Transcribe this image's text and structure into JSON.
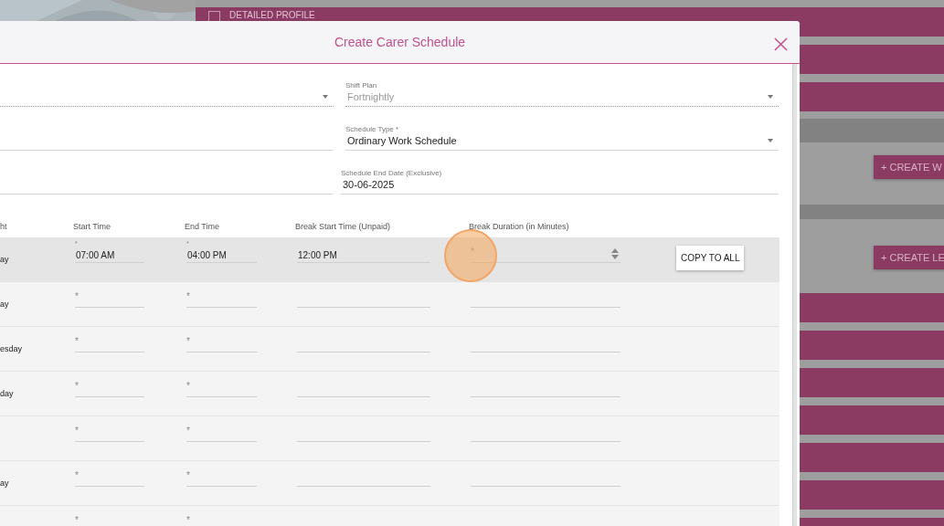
{
  "background": {
    "profile_label": "DETAILED PROFILE",
    "buttons": [
      "+ CREATE W",
      "+ CREATE LE"
    ]
  },
  "dialog": {
    "title": "Create Carer Schedule"
  },
  "fields": [
    {
      "kind": "select",
      "disabled": true
    },
    {
      "kind": "select",
      "label": "Shift Plan",
      "value": "Fortnightly",
      "disabled": true
    },
    {
      "kind": "text",
      "disabled": false
    },
    {
      "kind": "select",
      "label": "Schedule Type *",
      "value": "Ordinary Work Schedule",
      "disabled": false
    },
    {
      "kind": "text",
      "disabled": false
    },
    {
      "kind": "date",
      "label": "Schedule End Date (Exclusive)",
      "value": "30-06-2025",
      "disabled": false
    }
  ],
  "table": {
    "columns": [
      "ht",
      "Start Time",
      "End Time",
      "Break Start Time (Unpaid)",
      "Break Duration (in Minutes)"
    ],
    "rows": [
      {
        "day": "ay",
        "highlighted": true,
        "start": {
          "label": "*",
          "value": "07:00 AM"
        },
        "end": {
          "label": "*",
          "value": "04:00 PM"
        },
        "break_start": {
          "value": "12:00 PM"
        },
        "duration": {
          "label": "*"
        },
        "copy_button": "COPY TO ALL"
      },
      {
        "day": "ay",
        "highlighted": false,
        "start": {
          "label": "*"
        },
        "end": {
          "label": "*"
        },
        "break_start": {},
        "duration": {}
      },
      {
        "day": "esday",
        "highlighted": false,
        "start": {
          "label": "*"
        },
        "end": {
          "label": "*"
        },
        "break_start": {},
        "duration": {}
      },
      {
        "day": "day",
        "highlighted": false,
        "start": {
          "label": "*"
        },
        "end": {
          "label": "*"
        },
        "break_start": {},
        "duration": {}
      },
      {
        "highlighted": false,
        "start": {
          "label": "*"
        },
        "end": {
          "label": "*"
        },
        "break_start": {},
        "duration": {}
      },
      {
        "day": "ay",
        "highlighted": false,
        "start": {
          "label": "*"
        },
        "end": {
          "label": "*"
        },
        "break_start": {},
        "duration": {}
      },
      {
        "highlighted": false,
        "start": {
          "label": "*"
        },
        "end": {
          "label": "*"
        },
        "break_start": {},
        "duration": {}
      }
    ]
  }
}
